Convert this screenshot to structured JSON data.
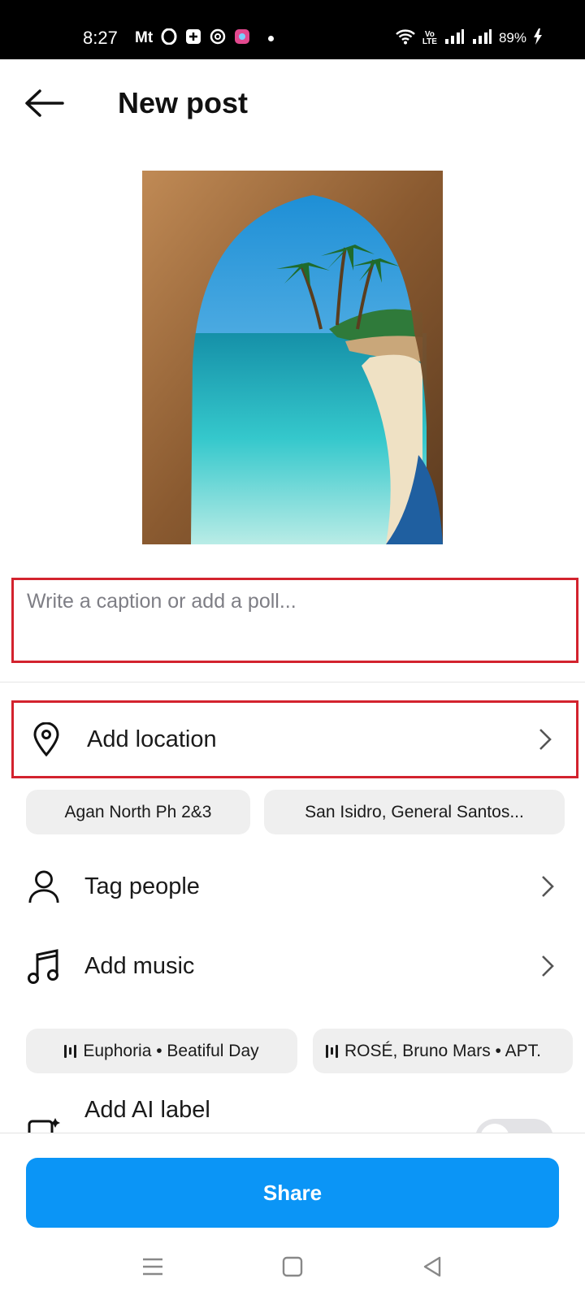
{
  "status_bar": {
    "time": "8:27",
    "carrier_glyph": "Mt",
    "battery_percent": "89%",
    "volte_top": "Vo",
    "volte_bottom": "LTE",
    "icons": [
      "opera-icon",
      "add-box-icon",
      "threads-icon",
      "app-icon",
      "wifi-icon",
      "signal-icon",
      "battery-charging-icon"
    ]
  },
  "header": {
    "title": "New post",
    "back_icon": "arrow-left-icon"
  },
  "caption": {
    "value": "",
    "placeholder": "Write a caption or add a poll..."
  },
  "location": {
    "label": "Add location",
    "icon": "location-pin-icon",
    "suggestions": [
      "Agan North Ph 2&3",
      "San Isidro, General Santos..."
    ]
  },
  "tag_people": {
    "label": "Tag people",
    "icon": "person-icon"
  },
  "music": {
    "label": "Add music",
    "icon": "music-note-icon",
    "suggestions": [
      "Euphoria • Beatiful Day",
      "ROSÉ, Bruno Mars • APT."
    ]
  },
  "ai_label": {
    "label": "Add AI label",
    "enabled": false
  },
  "share": {
    "label": "Share"
  },
  "colors": {
    "accent": "#0b95f6",
    "highlight_border": "#d3232e",
    "chip_bg": "#efefef"
  }
}
